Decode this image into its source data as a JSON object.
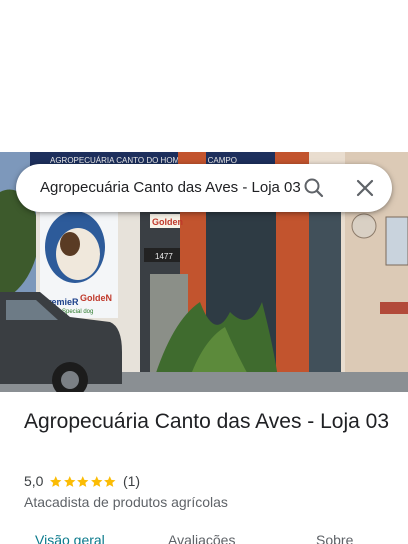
{
  "search": {
    "query": "Agropecuária Canto das Aves - Loja 03"
  },
  "photo": {
    "store_sign_top": "AGROPECUÁRIA CANTO DO HOMEM DO CAMPO",
    "brand_premier": "PremieR",
    "brand_golden": "GoldeN",
    "brand_special": "Special dog",
    "brand_golden_door": "Golden",
    "door_number": "1477"
  },
  "place": {
    "title": "Agropecuária Canto das Aves - Loja 03",
    "rating": "5,0",
    "review_count": "(1)",
    "star_count": 5,
    "category": "Atacadista de produtos agrícolas"
  },
  "tabs": [
    {
      "label": "Visão geral",
      "active": true
    },
    {
      "label": "Avaliações",
      "active": false
    },
    {
      "label": "Sobre",
      "active": false
    }
  ],
  "colors": {
    "star": "#fbbc04",
    "active_tab": "#0b7a8c",
    "title": "#202124",
    "secondary": "#5f6368"
  }
}
